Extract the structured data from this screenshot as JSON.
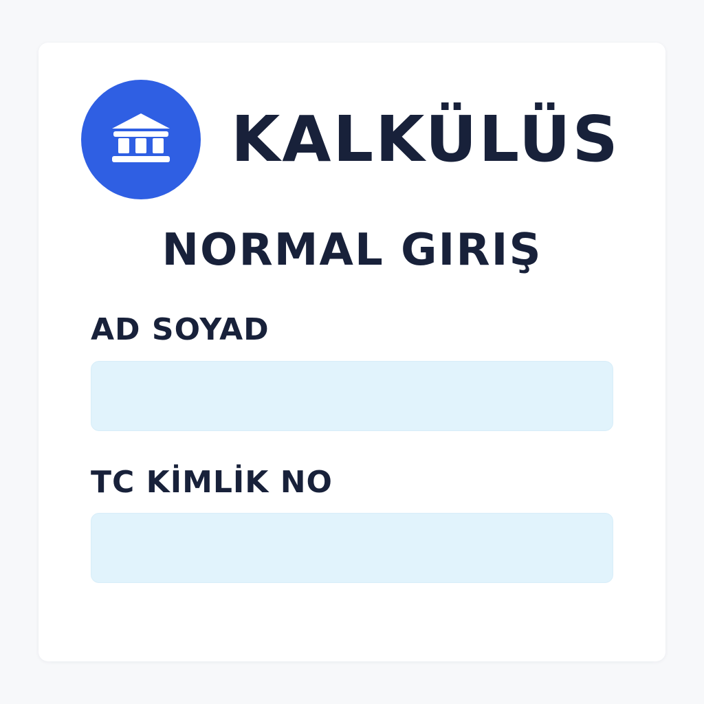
{
  "header": {
    "app_title": "KALKÜLÜS",
    "logo_icon": "bank-icon"
  },
  "form": {
    "title": "NORMAL GIRIŞ",
    "fields": [
      {
        "label": "AD SOYAD",
        "value": "",
        "placeholder": ""
      },
      {
        "label": "TC KİMLİK NO",
        "value": "",
        "placeholder": ""
      }
    ]
  },
  "colors": {
    "brand": "#2f5fe3",
    "text": "#18213a",
    "input_background": "#e1f3fc"
  }
}
